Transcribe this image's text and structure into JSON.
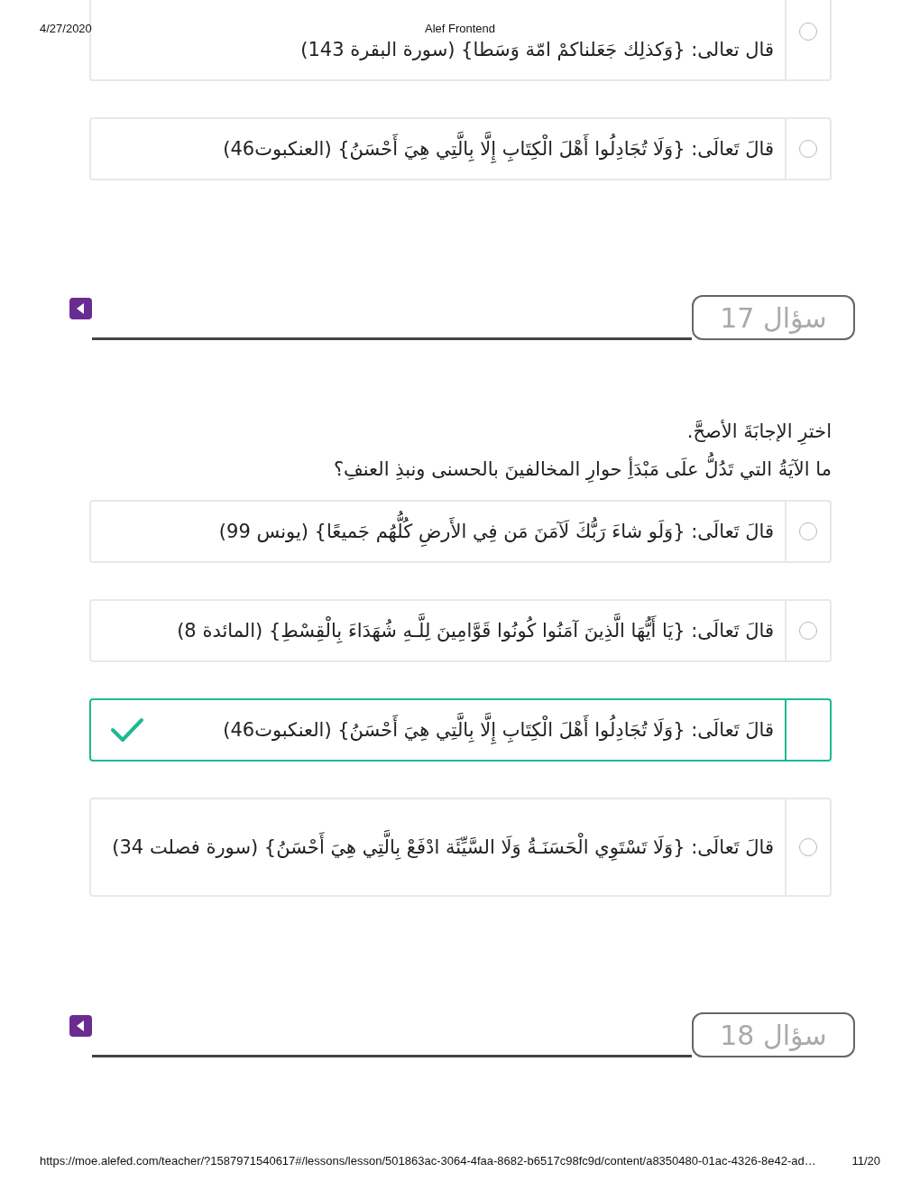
{
  "print_header": {
    "date": "4/27/2020",
    "title": "Alef Frontend"
  },
  "previous_options": [
    {
      "text": "قال تعالى: {وَكذلِك جَعَلناكمْ امّة وَسَطا} (سورة البقرة 143)",
      "correct": false
    },
    {
      "text": "قالَ تَعالَى: {وَلَا تُجَادِلُوا أَهْلَ الْكِتَابِ إِلَّا بِالَّتِي هِيَ أَحْسَنُ} (العنكبوت46)",
      "correct": false
    }
  ],
  "questions": [
    {
      "label": "سؤال 17",
      "instruction": "اخترِ الإجابَةَ الأصحَّ.",
      "prompt": "ما الآيَةُ التي تَدُلُّ علَى مَبْدَأِ  حوارِ المخالفينَ بالحسنى ونبذِ العنفِ؟",
      "options": [
        {
          "text": "قالَ تَعالَى: {وَلَو شاءَ رَبُّكَ لَآمَنَ مَن فِي الأَرضِ كُلُّهُم جَميعًا} (يونس 99)",
          "correct": false
        },
        {
          "text": "قالَ تَعالَى: {يَا أَيُّهَا الَّذِينَ آمَنُوا كُونُوا قَوَّامِينَ لِلَّـهِ شُهَدَاءَ بِالْقِسْطِ} (المائدة 8)",
          "correct": false
        },
        {
          "text": "قالَ تَعالَى: {وَلَا تُجَادِلُوا أَهْلَ الْكِتَابِ إِلَّا بِالَّتِي هِيَ أَحْسَنُ} (العنكبوت46)",
          "correct": true
        },
        {
          "text": "قالَ تَعالَى: {وَلَا تَسْتَوِي الْحَسَنَـةُ وَلَا السَّيِّئَة  ادْفَعْ بِالَّتِي هِيَ أَحْسَنُ} (سورة فصلت 34)",
          "correct": false
        }
      ]
    },
    {
      "label": "سؤال 18"
    }
  ],
  "print_footer": {
    "url": "https://moe.alefed.com/teacher/?1587971540617#/lessons/lesson/501863ac-3064-4faa-8682-b6517c98fc9d/content/a8350480-01ac-4326-8e42-ad…",
    "page": "11/20"
  }
}
